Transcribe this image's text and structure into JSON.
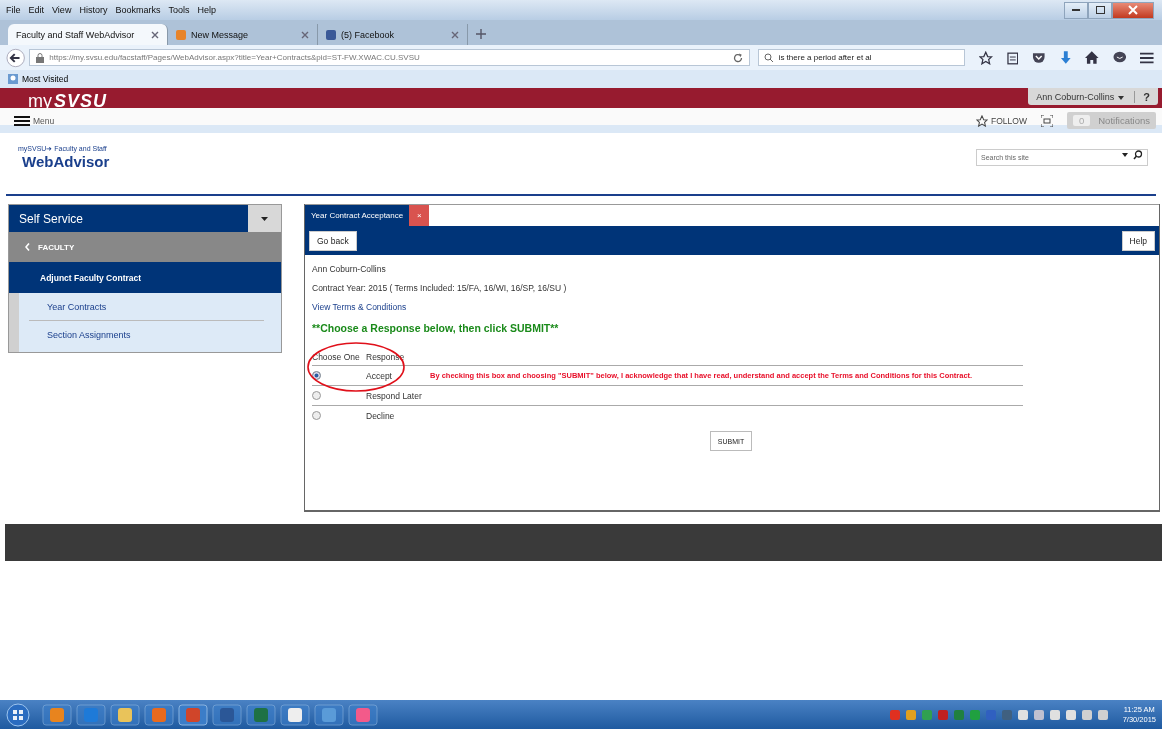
{
  "browser": {
    "menu": [
      "File",
      "Edit",
      "View",
      "History",
      "Bookmarks",
      "Tools",
      "Help"
    ],
    "tabs": [
      {
        "label": "Faculty and Staff WebAdvisor",
        "selected": true
      },
      {
        "label": "New Message",
        "selected": false
      },
      {
        "label": "(5) Facebook",
        "selected": false
      }
    ],
    "url": "https://my.svsu.edu/facstaff/Pages/WebAdvisor.aspx?title=Year+Contracts&pid=ST-FW.XWAC.CU.SVSU",
    "search_value": "is there a period after et al",
    "bookmarks": [
      "Most Visited"
    ]
  },
  "site": {
    "logo_prefix": "my",
    "logo": "SVSU",
    "user": "Ann Coburn-Collins",
    "help": "?",
    "menu": "Menu",
    "follow": "FOLLOW",
    "notification_count": "0",
    "notifications": "Notifications",
    "breadcrumb": "mySVSU➜ Faculty and Staff",
    "title": "WebAdvisor",
    "search_placeholder": "Search this site"
  },
  "sidebar": {
    "title": "Self Service",
    "section": "FACULTY",
    "group": "Adjunct Faculty Contract",
    "items": [
      "Year Contracts",
      "Section Assignments"
    ]
  },
  "panel": {
    "tab": "Year Contract Acceptance",
    "close": "×",
    "back": "Go back",
    "help": "Help",
    "name": "Ann Coburn-Collins",
    "contract_year": "Contract Year: 2015 ( Terms Included: 15/FA, 16/WI, 16/SP, 16/SU )",
    "terms_link": "View Terms & Conditions",
    "instruction": "**Choose a Response below, then click SUBMIT**",
    "columns": [
      "Choose One",
      "Response"
    ],
    "responses": [
      {
        "label": "Accept",
        "selected": true,
        "note": "By checking this box and choosing \"SUBMIT\" below, I acknowledge that I have read, understand and accept the Terms and Conditions for this Contract."
      },
      {
        "label": "Respond Later",
        "selected": false
      },
      {
        "label": "Decline",
        "selected": false
      }
    ],
    "submit": "SUBMIT"
  },
  "taskbar": {
    "time": "11:25 AM",
    "date": "7/30/2015"
  }
}
